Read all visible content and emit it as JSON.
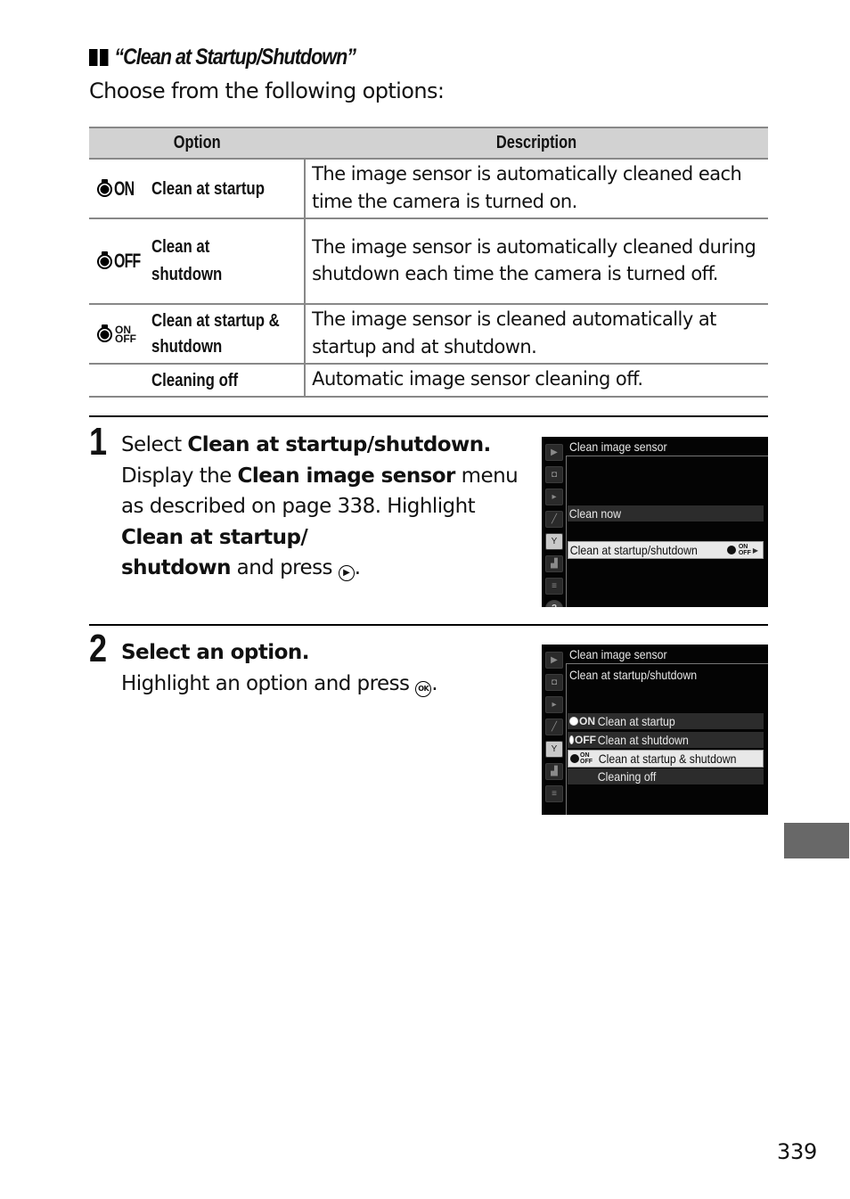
{
  "section": {
    "heading": "“Clean at Startup/Shutdown”",
    "intro": "Choose from the following options:"
  },
  "table": {
    "headers": [
      "Option",
      "Description"
    ],
    "rows": [
      {
        "icon": "clean-at-startup-icon",
        "icon_text": "ON",
        "option": "Clean at startup",
        "description": "The image sensor is automatically cleaned each time the camera is turned on."
      },
      {
        "icon": "clean-at-shutdown-icon",
        "icon_text": "OFF",
        "option": "Clean at shutdown",
        "description": "The image sensor is automatically cleaned during shutdown each time the camera is turned off."
      },
      {
        "icon": "clean-at-startup-and-shutdown-icon",
        "icon_text_top": "ON",
        "icon_text_bottom": "OFF",
        "option": "Clean at startup & shutdown",
        "description": "The image sensor is cleaned automatically at startup and at shutdown."
      },
      {
        "icon": "",
        "option": "Cleaning off",
        "description": "Automatic image sensor cleaning off."
      }
    ]
  },
  "steps": [
    {
      "number": "1",
      "title_prefix": "Select ",
      "title_bold": "Clean at startup/shutdown.",
      "body": {
        "t1": "Display the ",
        "b1": "Clean image sensor",
        "t2": " menu as described on page 338. Highlight ",
        "b2": "Clean at startup/ shutdown",
        "t3": " and press ",
        "button": "multi-selector-right",
        "t4": "."
      },
      "screen": {
        "title": "Clean image sensor",
        "items": [
          "Clean now",
          "Clean at startup/shutdown"
        ],
        "selected_index": 1,
        "selected_value_icon_top": "ON",
        "selected_value_icon_bottom": "OFF",
        "tabs": [
          "playback",
          "photo-shooting",
          "movie-shooting",
          "custom-settings",
          "setup",
          "retouch",
          "my-menu",
          "help"
        ],
        "active_tab": "setup"
      }
    },
    {
      "number": "2",
      "title_bold": "Select an option.",
      "body": {
        "t1": "Highlight an option and press ",
        "button": "OK",
        "t2": "."
      },
      "screen": {
        "title": "Clean image sensor",
        "subtitle": "Clean at startup/shutdown",
        "items": [
          {
            "icon_text": "ON",
            "label": "Clean at startup"
          },
          {
            "icon_text": "OFF",
            "label": "Clean at shutdown"
          },
          {
            "icon_text_top": "ON",
            "icon_text_bottom": "OFF",
            "label": "Clean at startup & shutdown"
          },
          {
            "icon_text": "",
            "label": "Cleaning off"
          }
        ],
        "selected_index": 2,
        "tabs": [
          "playback",
          "photo-shooting",
          "movie-shooting",
          "custom-settings",
          "setup",
          "retouch",
          "my-menu"
        ],
        "active_tab": "setup"
      }
    }
  ],
  "ok_glyph": "OK",
  "right_glyph": "▶",
  "page_number": "339",
  "colors": {
    "table_header_bg": "#d2d2d2",
    "rule_gray": "#888888",
    "thumb_tab": "#686868",
    "screen_bg": "#040404"
  }
}
